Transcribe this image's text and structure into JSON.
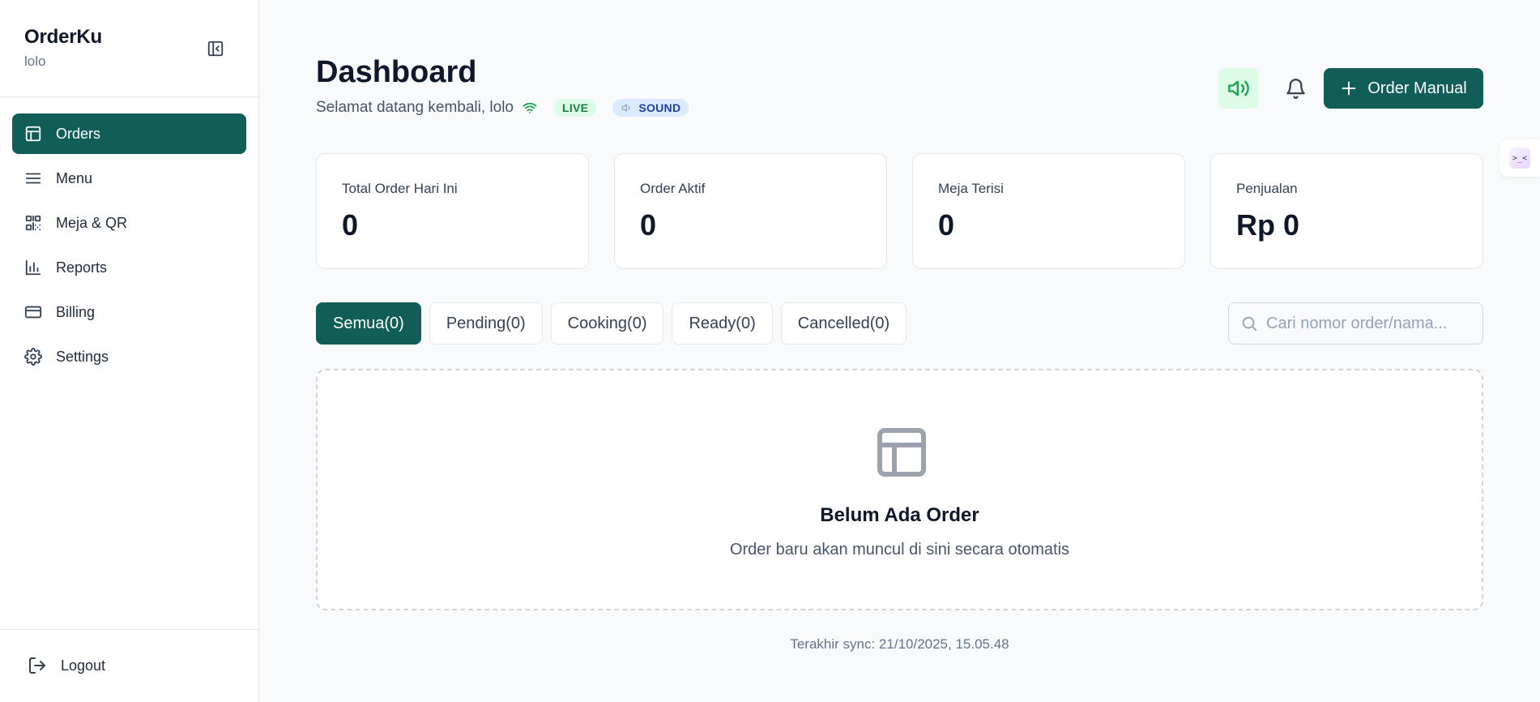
{
  "brand": {
    "name": "OrderKu",
    "user": "lolo"
  },
  "sidebar": {
    "items": [
      {
        "label": "Orders",
        "icon": "table-icon",
        "active": true
      },
      {
        "label": "Menu",
        "icon": "menu-icon",
        "active": false
      },
      {
        "label": "Meja & QR",
        "icon": "qr-icon",
        "active": false
      },
      {
        "label": "Reports",
        "icon": "chart-icon",
        "active": false
      },
      {
        "label": "Billing",
        "icon": "card-icon",
        "active": false
      },
      {
        "label": "Settings",
        "icon": "gear-icon",
        "active": false
      }
    ],
    "logout": "Logout"
  },
  "header": {
    "title": "Dashboard",
    "welcome": "Selamat datang kembali, lolo",
    "live_badge": "LIVE",
    "sound_badge": "SOUND",
    "order_manual": "Order Manual"
  },
  "stats": [
    {
      "label": "Total Order Hari Ini",
      "value": "0"
    },
    {
      "label": "Order Aktif",
      "value": "0"
    },
    {
      "label": "Meja Terisi",
      "value": "0"
    },
    {
      "label": "Penjualan",
      "value": "Rp 0"
    }
  ],
  "tabs": [
    {
      "label": "Semua(0)",
      "active": true
    },
    {
      "label": "Pending(0)",
      "active": false
    },
    {
      "label": "Cooking(0)",
      "active": false
    },
    {
      "label": "Ready(0)",
      "active": false
    },
    {
      "label": "Cancelled(0)",
      "active": false
    }
  ],
  "search": {
    "placeholder": "Cari nomor order/nama...",
    "value": ""
  },
  "empty": {
    "title": "Belum Ada Order",
    "subtitle": "Order baru akan muncul di sini secara otomatis"
  },
  "sync": "Terakhir sync: 21/10/2025, 15.05.48",
  "widget": {
    "face": ">_<"
  },
  "colors": {
    "primary": "#115e59",
    "live_bg": "#dcfce7",
    "live_fg": "#15803d",
    "sound_bg": "#dbeafe",
    "sound_fg": "#1e40af"
  }
}
